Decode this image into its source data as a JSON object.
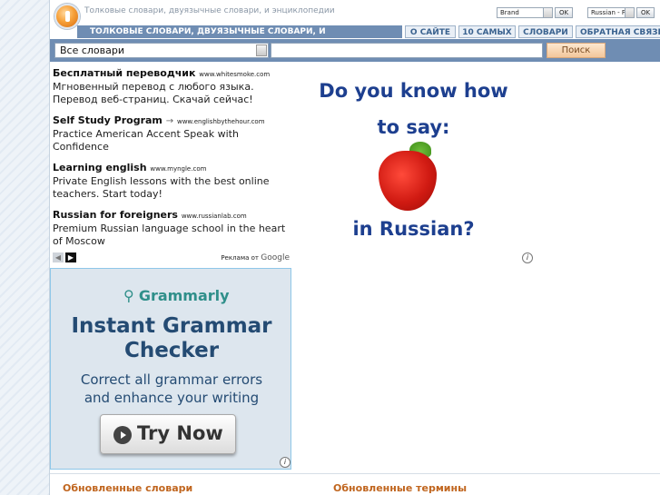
{
  "header": {
    "tagline": "Толковые словари, двуязычные словари, и энциклопедии",
    "brand_select": "Brand",
    "lang_select": "Russian - F",
    "ok1": "OK",
    "ok2": "OK"
  },
  "nav": {
    "main": "ТОЛКОВЫЕ СЛОВАРИ, ДВУЯЗЫЧНЫЕ СЛОВАРИ, И ЭНЦИКЛОПЕДИИ",
    "tabs": [
      "О САЙТЕ",
      "10 САМЫХ",
      "СЛОВАРИ",
      "ОБРАТНАЯ СВЯЗЬ"
    ]
  },
  "search": {
    "dictionary_select": "Все словари",
    "input_value": "",
    "button": "Поиск"
  },
  "ads": [
    {
      "title": "Бесплатный переводчик",
      "url": "www.whitesmoke.com",
      "body": "Мгновенный перевод с любого языка. Перевод веб-страниц. Скачай сейчас!"
    },
    {
      "title": "Self Study Program",
      "url": "www.englishbythehour.com",
      "body": "Practice American Accent Speak with Confidence"
    },
    {
      "title": "Learning english",
      "url": "www.myngle.com",
      "body": "Private English lessons with the best online teachers. Start today!"
    },
    {
      "title": "Russian for foreigners",
      "url": "www.russianlab.com",
      "body": "Premium Russian language school in the heart of Moscow"
    }
  ],
  "ads_footer": {
    "prefix": "Реклама от",
    "brand": "Google"
  },
  "banner_strawberry": {
    "line1": "Do you know how",
    "line2": "to say:",
    "line3": "in Russian?"
  },
  "banner_grammarly": {
    "logo": "Grammarly",
    "headline1": "Instant Grammar",
    "headline2": "Checker",
    "sub1": "Correct all grammar errors",
    "sub2": "and enhance your writing",
    "cta": "Try Now"
  },
  "bottom": {
    "updated_dictionaries": "Обновленные словари",
    "updated_terms": "Обновленные термины"
  },
  "colors": {
    "nav_blue": "#6f8db3",
    "tab_text": "#3a628f",
    "heading_orange": "#c0651e",
    "banner_blue": "#1d3f8f"
  }
}
